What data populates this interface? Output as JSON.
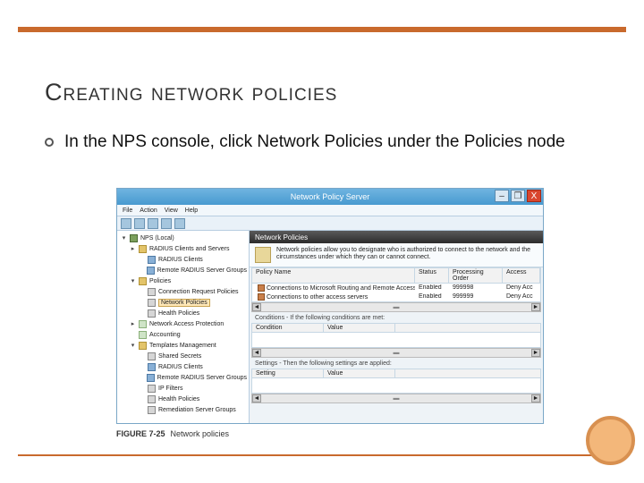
{
  "slide": {
    "title": "Creating network policies",
    "bullet": "In the NPS console, click Network Policies under the Policies node",
    "figure_caption_label": "FIGURE 7-25",
    "figure_caption_text": "Network policies"
  },
  "window": {
    "title": "Network Policy Server",
    "buttons": {
      "min": "–",
      "max": "❐",
      "close": "X"
    },
    "menu": [
      "File",
      "Action",
      "View",
      "Help"
    ]
  },
  "tree": {
    "root": "NPS (Local)",
    "items": [
      {
        "l": 1,
        "exp": "▸",
        "ico": "ico-folder",
        "label": "RADIUS Clients and Servers"
      },
      {
        "l": 2,
        "exp": "",
        "ico": "ico-users",
        "label": "RADIUS Clients"
      },
      {
        "l": 2,
        "exp": "",
        "ico": "ico-users",
        "label": "Remote RADIUS Server Groups"
      },
      {
        "l": 1,
        "exp": "▾",
        "ico": "ico-folder",
        "label": "Policies"
      },
      {
        "l": 2,
        "exp": "",
        "ico": "ico-policy",
        "label": "Connection Request Policies"
      },
      {
        "l": 2,
        "exp": "",
        "ico": "ico-policy",
        "label": "Network Policies",
        "sel": true
      },
      {
        "l": 2,
        "exp": "",
        "ico": "ico-policy",
        "label": "Health Policies"
      },
      {
        "l": 1,
        "exp": "▸",
        "ico": "ico-doc",
        "label": "Network Access Protection"
      },
      {
        "l": 1,
        "exp": "",
        "ico": "ico-doc",
        "label": "Accounting"
      },
      {
        "l": 1,
        "exp": "▾",
        "ico": "ico-folder",
        "label": "Templates Management"
      },
      {
        "l": 2,
        "exp": "",
        "ico": "ico-policy",
        "label": "Shared Secrets"
      },
      {
        "l": 2,
        "exp": "",
        "ico": "ico-users",
        "label": "RADIUS Clients"
      },
      {
        "l": 2,
        "exp": "",
        "ico": "ico-users",
        "label": "Remote RADIUS Server Groups"
      },
      {
        "l": 2,
        "exp": "",
        "ico": "ico-policy",
        "label": "IP Filters"
      },
      {
        "l": 2,
        "exp": "",
        "ico": "ico-policy",
        "label": "Health Policies"
      },
      {
        "l": 2,
        "exp": "",
        "ico": "ico-policy",
        "label": "Remediation Server Groups"
      }
    ]
  },
  "content": {
    "header": "Network Policies",
    "description": "Network policies allow you to designate who is authorized to connect to the network and the circumstances under which they can or cannot connect.",
    "columns": {
      "name": "Policy Name",
      "status": "Status",
      "order": "Processing Order",
      "access": "Access"
    },
    "rows": [
      {
        "name": "Connections to Microsoft Routing and Remote Access server",
        "status": "Enabled",
        "order": "999998",
        "access": "Deny Acc"
      },
      {
        "name": "Connections to other access servers",
        "status": "Enabled",
        "order": "999999",
        "access": "Deny Acc"
      }
    ],
    "conditions_label": "Conditions - If the following conditions are met:",
    "cond_cols": {
      "c": "Condition",
      "v": "Value"
    },
    "settings_label": "Settings - Then the following settings are applied:",
    "set_cols": {
      "s": "Setting",
      "v": "Value"
    },
    "scroll": {
      "left": "◄",
      "right": "►",
      "thumb": "▬"
    }
  }
}
